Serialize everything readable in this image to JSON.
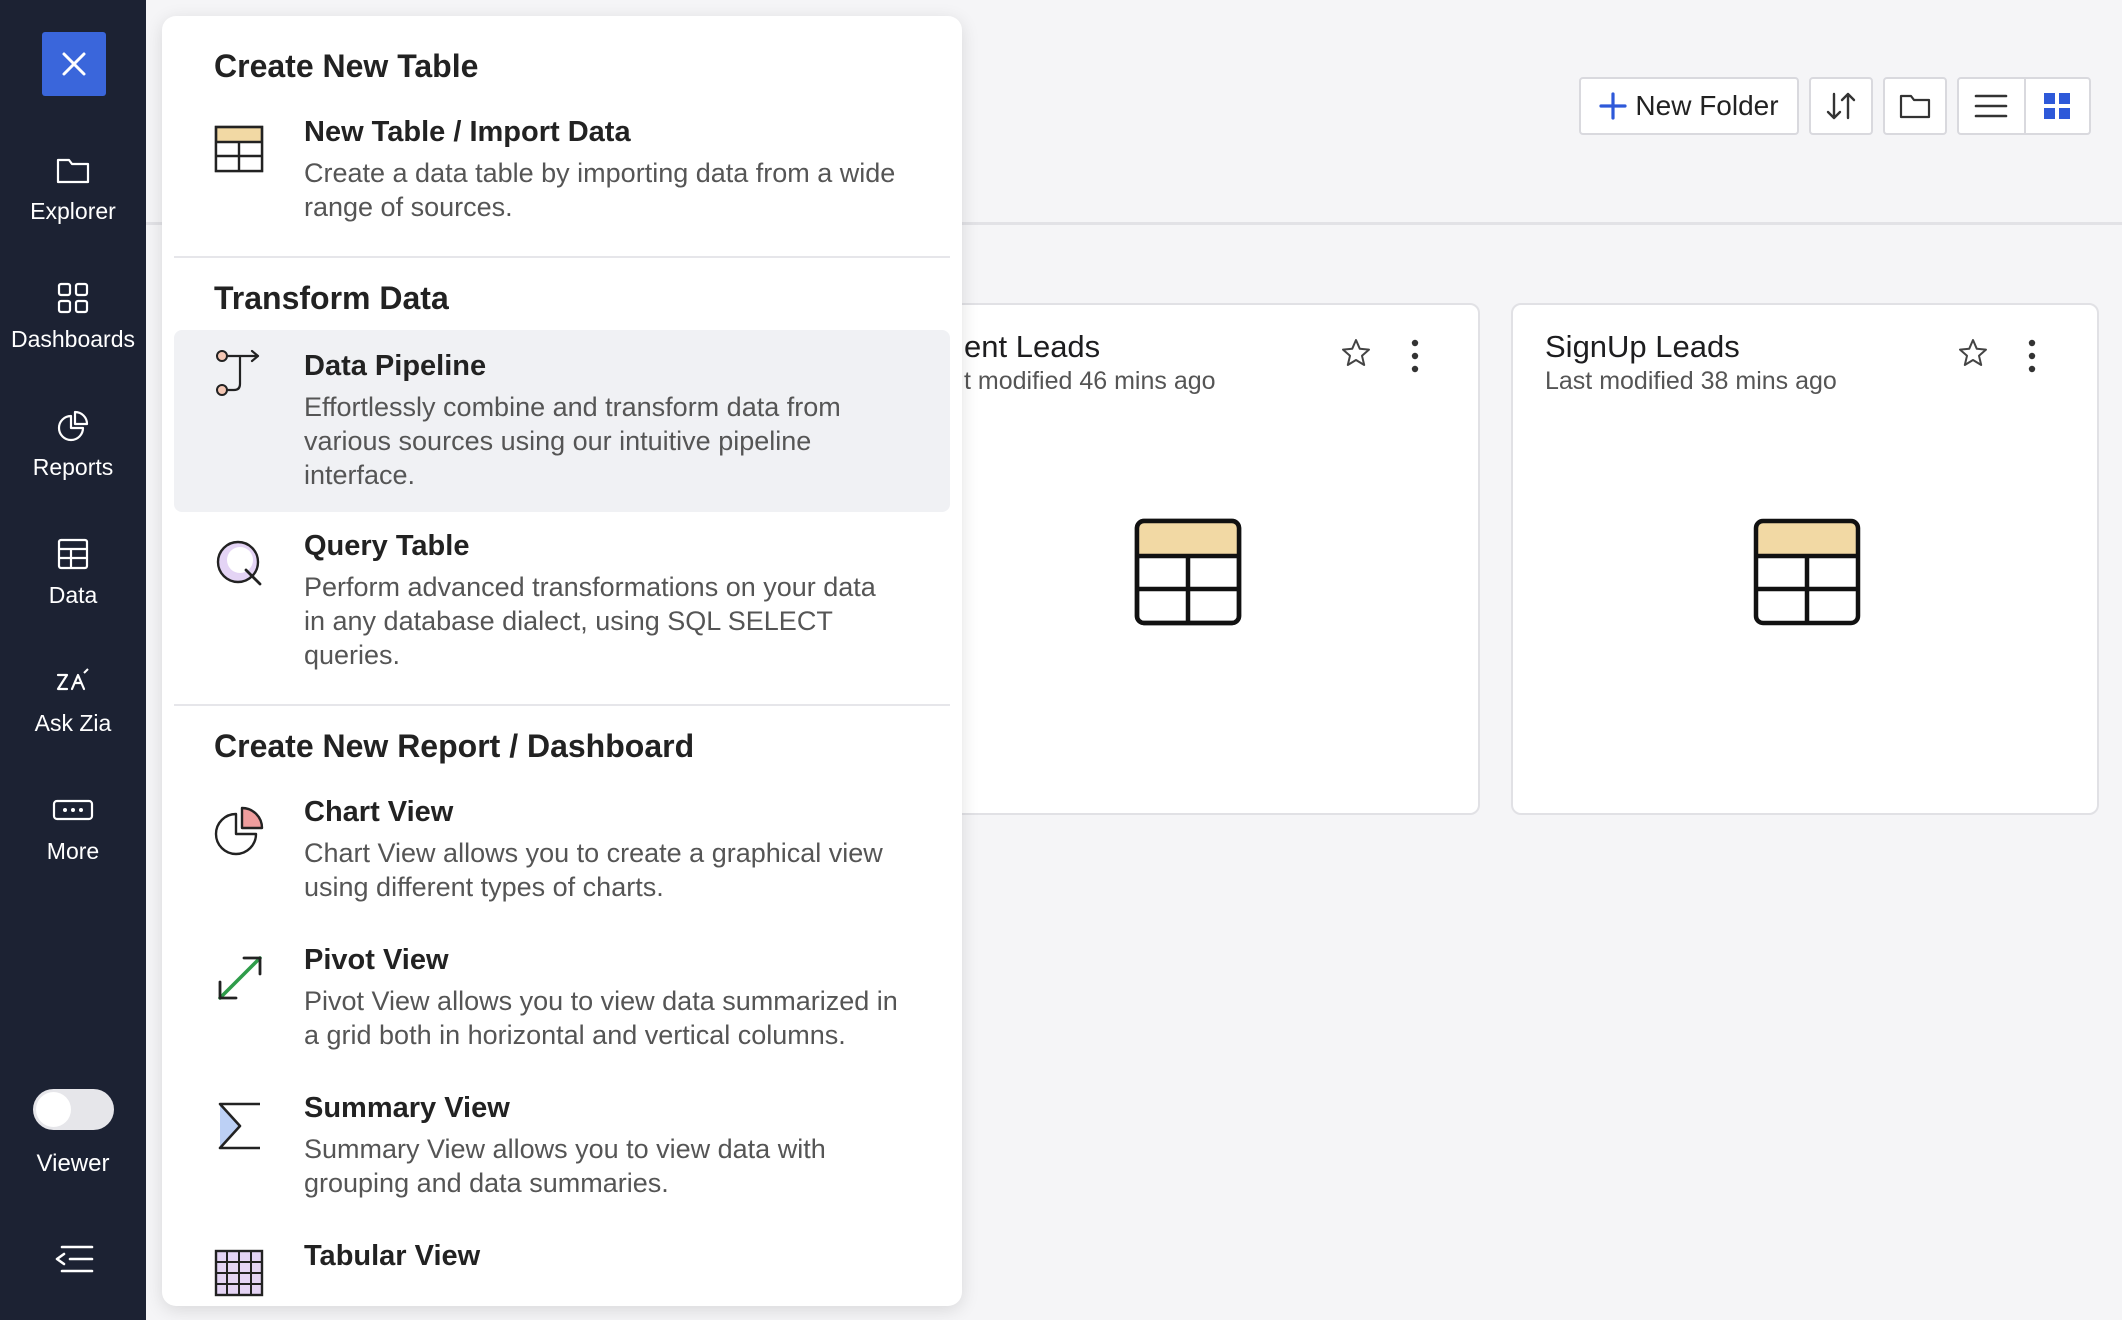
{
  "sidebar": {
    "items": [
      {
        "label": "Explorer",
        "icon": "folder-icon"
      },
      {
        "label": "Dashboards",
        "icon": "grid-icon"
      },
      {
        "label": "Reports",
        "icon": "pie-chart-icon"
      },
      {
        "label": "Data",
        "icon": "table-icon"
      },
      {
        "label": "Ask Zia",
        "icon": "zia-icon"
      },
      {
        "label": "More",
        "icon": "more-icon"
      }
    ],
    "viewer_label": "Viewer"
  },
  "toolbar": {
    "new_folder_label": "New Folder"
  },
  "cards": [
    {
      "title": "ent Leads",
      "subtitle": "t modified 46 mins ago"
    },
    {
      "title": "SignUp Leads",
      "subtitle": "Last modified 38 mins ago"
    }
  ],
  "menu": {
    "sections": [
      {
        "title": "Create New Table"
      },
      {
        "title": "Transform Data"
      },
      {
        "title": "Create New Report / Dashboard"
      }
    ],
    "items": [
      {
        "title": "New Table / Import Data",
        "desc": "Create a data table by importing data from a wide range of sources."
      },
      {
        "title": "Data Pipeline",
        "desc": "Effortlessly combine and transform data from various sources using our intuitive pipeline interface."
      },
      {
        "title": "Query Table",
        "desc": "Perform advanced transformations on your data in any database dialect, using SQL SELECT queries."
      },
      {
        "title": "Chart View",
        "desc": "Chart View allows you to create a graphical view using different types of charts."
      },
      {
        "title": "Pivot View",
        "desc": "Pivot View allows you to view data summarized in a grid both in horizontal and vertical columns."
      },
      {
        "title": "Summary View",
        "desc": "Summary View allows you to view data with grouping and data summaries."
      },
      {
        "title": "Tabular View",
        "desc": ""
      }
    ]
  },
  "colors": {
    "sidebar_bg": "#1c2233",
    "accent_blue": "#3a66db",
    "table_header_fill": "#f2d9a4"
  }
}
